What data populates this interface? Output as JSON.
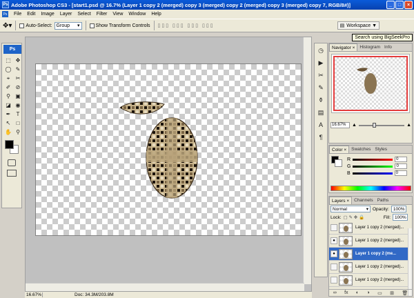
{
  "window": {
    "app_icon": "Ps",
    "title": "Adobe Photoshop CS3 - [start1.psd @ 16.7% (Layer 1 copy 2 (merged) copy 3 (merged) copy 2 (merged) copy 3 (merged) copy 7, RGB/8#)]",
    "controls": [
      "_",
      "□",
      "×"
    ]
  },
  "menu": [
    "File",
    "Edit",
    "Image",
    "Layer",
    "Select",
    "Filter",
    "View",
    "Window",
    "Help"
  ],
  "options": {
    "move_icon": "move-tool-icon",
    "auto_select_label": "Auto-Select:",
    "auto_select_value": "Group",
    "show_transform_label": "Show Transform Controls",
    "workspace_label": "Workspace ▼",
    "tooltip": "Search using BigSeekPro"
  },
  "toolbox": {
    "logo": "Ps",
    "tools": [
      "⬚",
      "✥",
      "◯",
      "✎",
      "⌖",
      "✂",
      "✐",
      "⊘",
      "⚲",
      "▣",
      "◪",
      "◉",
      "✒",
      "T",
      "↖",
      "□",
      "✋",
      "⚲"
    ]
  },
  "document": {
    "status_zoom": "16.67%",
    "status_doc": "Doc: 34.3M/203.8M"
  },
  "navigator": {
    "tabs": [
      "Navigator ×",
      "Histogram",
      "Info"
    ],
    "zoom": "16.67%"
  },
  "color": {
    "tabs": [
      "Color ×",
      "Swatches",
      "Styles"
    ],
    "channels": [
      {
        "label": "R",
        "value": "0",
        "gradient": "#ff0000"
      },
      {
        "label": "G",
        "value": "0",
        "gradient": "#00ff00"
      },
      {
        "label": "B",
        "value": "0",
        "gradient": "#0000ff"
      }
    ]
  },
  "layers": {
    "tabs": [
      "Layers ×",
      "Channels",
      "Paths"
    ],
    "blend_mode": "Normal",
    "opacity_label": "Opacity:",
    "opacity_value": "100%",
    "lock_label": "Lock:",
    "fill_label": "Fill:",
    "fill_value": "100%",
    "items": [
      {
        "name": "Layer 1 copy 2 (merged)...",
        "visible": false,
        "active": false
      },
      {
        "name": "Layer 1 copy 2 (merged)...",
        "visible": true,
        "active": false
      },
      {
        "name": "Layer 1 copy 2 (me...",
        "visible": true,
        "active": true
      },
      {
        "name": "Layer 1 copy 2 (merged)...",
        "visible": false,
        "active": false
      },
      {
        "name": "Layer 1 copy 2 (merged)...",
        "visible": false,
        "active": false
      }
    ],
    "footer_icons": [
      "∞",
      "fx",
      "◐",
      "◑",
      "▭",
      "⊞",
      "🗑"
    ]
  },
  "accent": "#3169c6"
}
